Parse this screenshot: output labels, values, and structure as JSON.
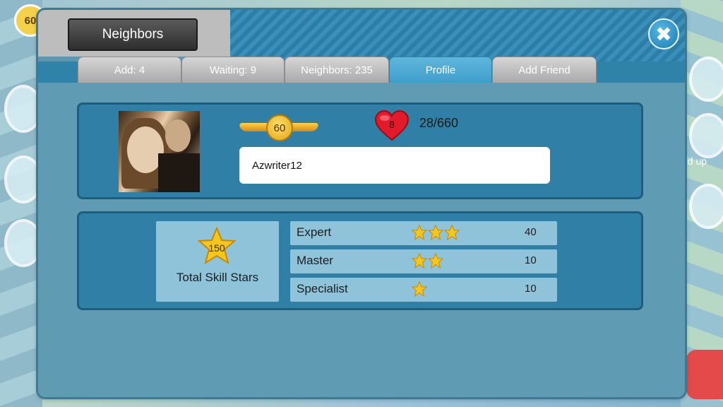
{
  "background": {
    "player_level": "60",
    "side_text": "ed up"
  },
  "window": {
    "title": "Neighbors",
    "close_symbol": "✖"
  },
  "tabs": [
    {
      "label": "Add: 4",
      "active": false
    },
    {
      "label": "Waiting: 9",
      "active": false
    },
    {
      "label": "Neighbors: 235",
      "active": false
    },
    {
      "label": "Profile",
      "active": true
    },
    {
      "label": "Add Friend",
      "active": false
    }
  ],
  "profile": {
    "level": "60",
    "hearts": "8",
    "hearts_progress": "28/660",
    "username": "Azwriter12"
  },
  "skills": {
    "total_value": "150",
    "total_label": "Total Skill Stars",
    "rows": [
      {
        "label": "Expert",
        "stars": 3,
        "count": "40"
      },
      {
        "label": "Master",
        "stars": 2,
        "count": "10"
      },
      {
        "label": "Specialist",
        "stars": 1,
        "count": "10"
      }
    ]
  },
  "colors": {
    "accent": "#3e9fcb",
    "panel": "#5e98b0",
    "star": "#f7c61a",
    "heart": "#e21a2a"
  }
}
